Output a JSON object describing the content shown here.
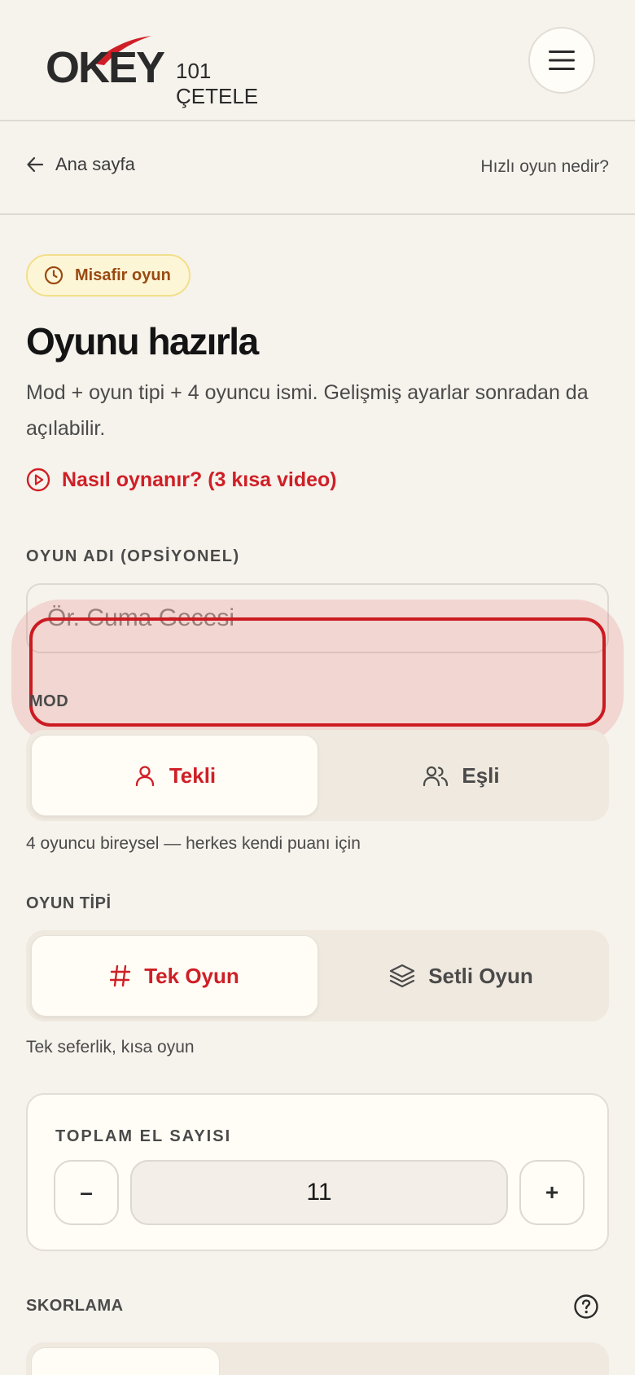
{
  "header": {
    "logo_main": "OKEY",
    "logo_sub": "101 ÇETELE",
    "menu_icon": "hamburger-icon"
  },
  "subnav": {
    "back_label": "Ana sayfa",
    "back_icon": "arrow-left-icon",
    "help_label": "Hızlı oyun nedir?"
  },
  "badge": {
    "label": "Misafir oyun",
    "icon": "clock-icon",
    "bg": "#fdf6d6",
    "color": "#9a4a12"
  },
  "main": {
    "title": "Oyunu hazırla",
    "description": "Mod + oyun tipi + 4 oyuncu ismi. Gelişmiş ayarlar sonradan da açılabilir.",
    "video_link": "Nasıl oynanır? (3 kısa video)",
    "video_icon": "play-circle-icon",
    "accent": "#cf1f26"
  },
  "game_name": {
    "label": "OYUN ADI (OPSİYONEL)",
    "value": "",
    "placeholder": "Ör. Cuma Gecesi"
  },
  "mode": {
    "label": "MOD",
    "options": [
      {
        "label": "Tekli",
        "icon": "user-icon",
        "selected": true
      },
      {
        "label": "Eşli",
        "icon": "users-icon",
        "selected": false
      }
    ],
    "helper": "4 oyuncu bireysel — herkes kendi puanı için"
  },
  "game_type": {
    "label": "OYUN TİPİ",
    "options": [
      {
        "label": "Tek Oyun",
        "icon": "hash-icon",
        "selected": true
      },
      {
        "label": "Setli Oyun",
        "icon": "layers-icon",
        "selected": false
      }
    ],
    "helper": "Tek seferlik, kısa oyun"
  },
  "hand_count": {
    "label": "TOPLAM EL SAYISI",
    "value": "11",
    "decrement": "–",
    "increment": "+"
  },
  "scoring": {
    "label": "SKORLAMA",
    "help_icon": "help-circle-icon"
  }
}
